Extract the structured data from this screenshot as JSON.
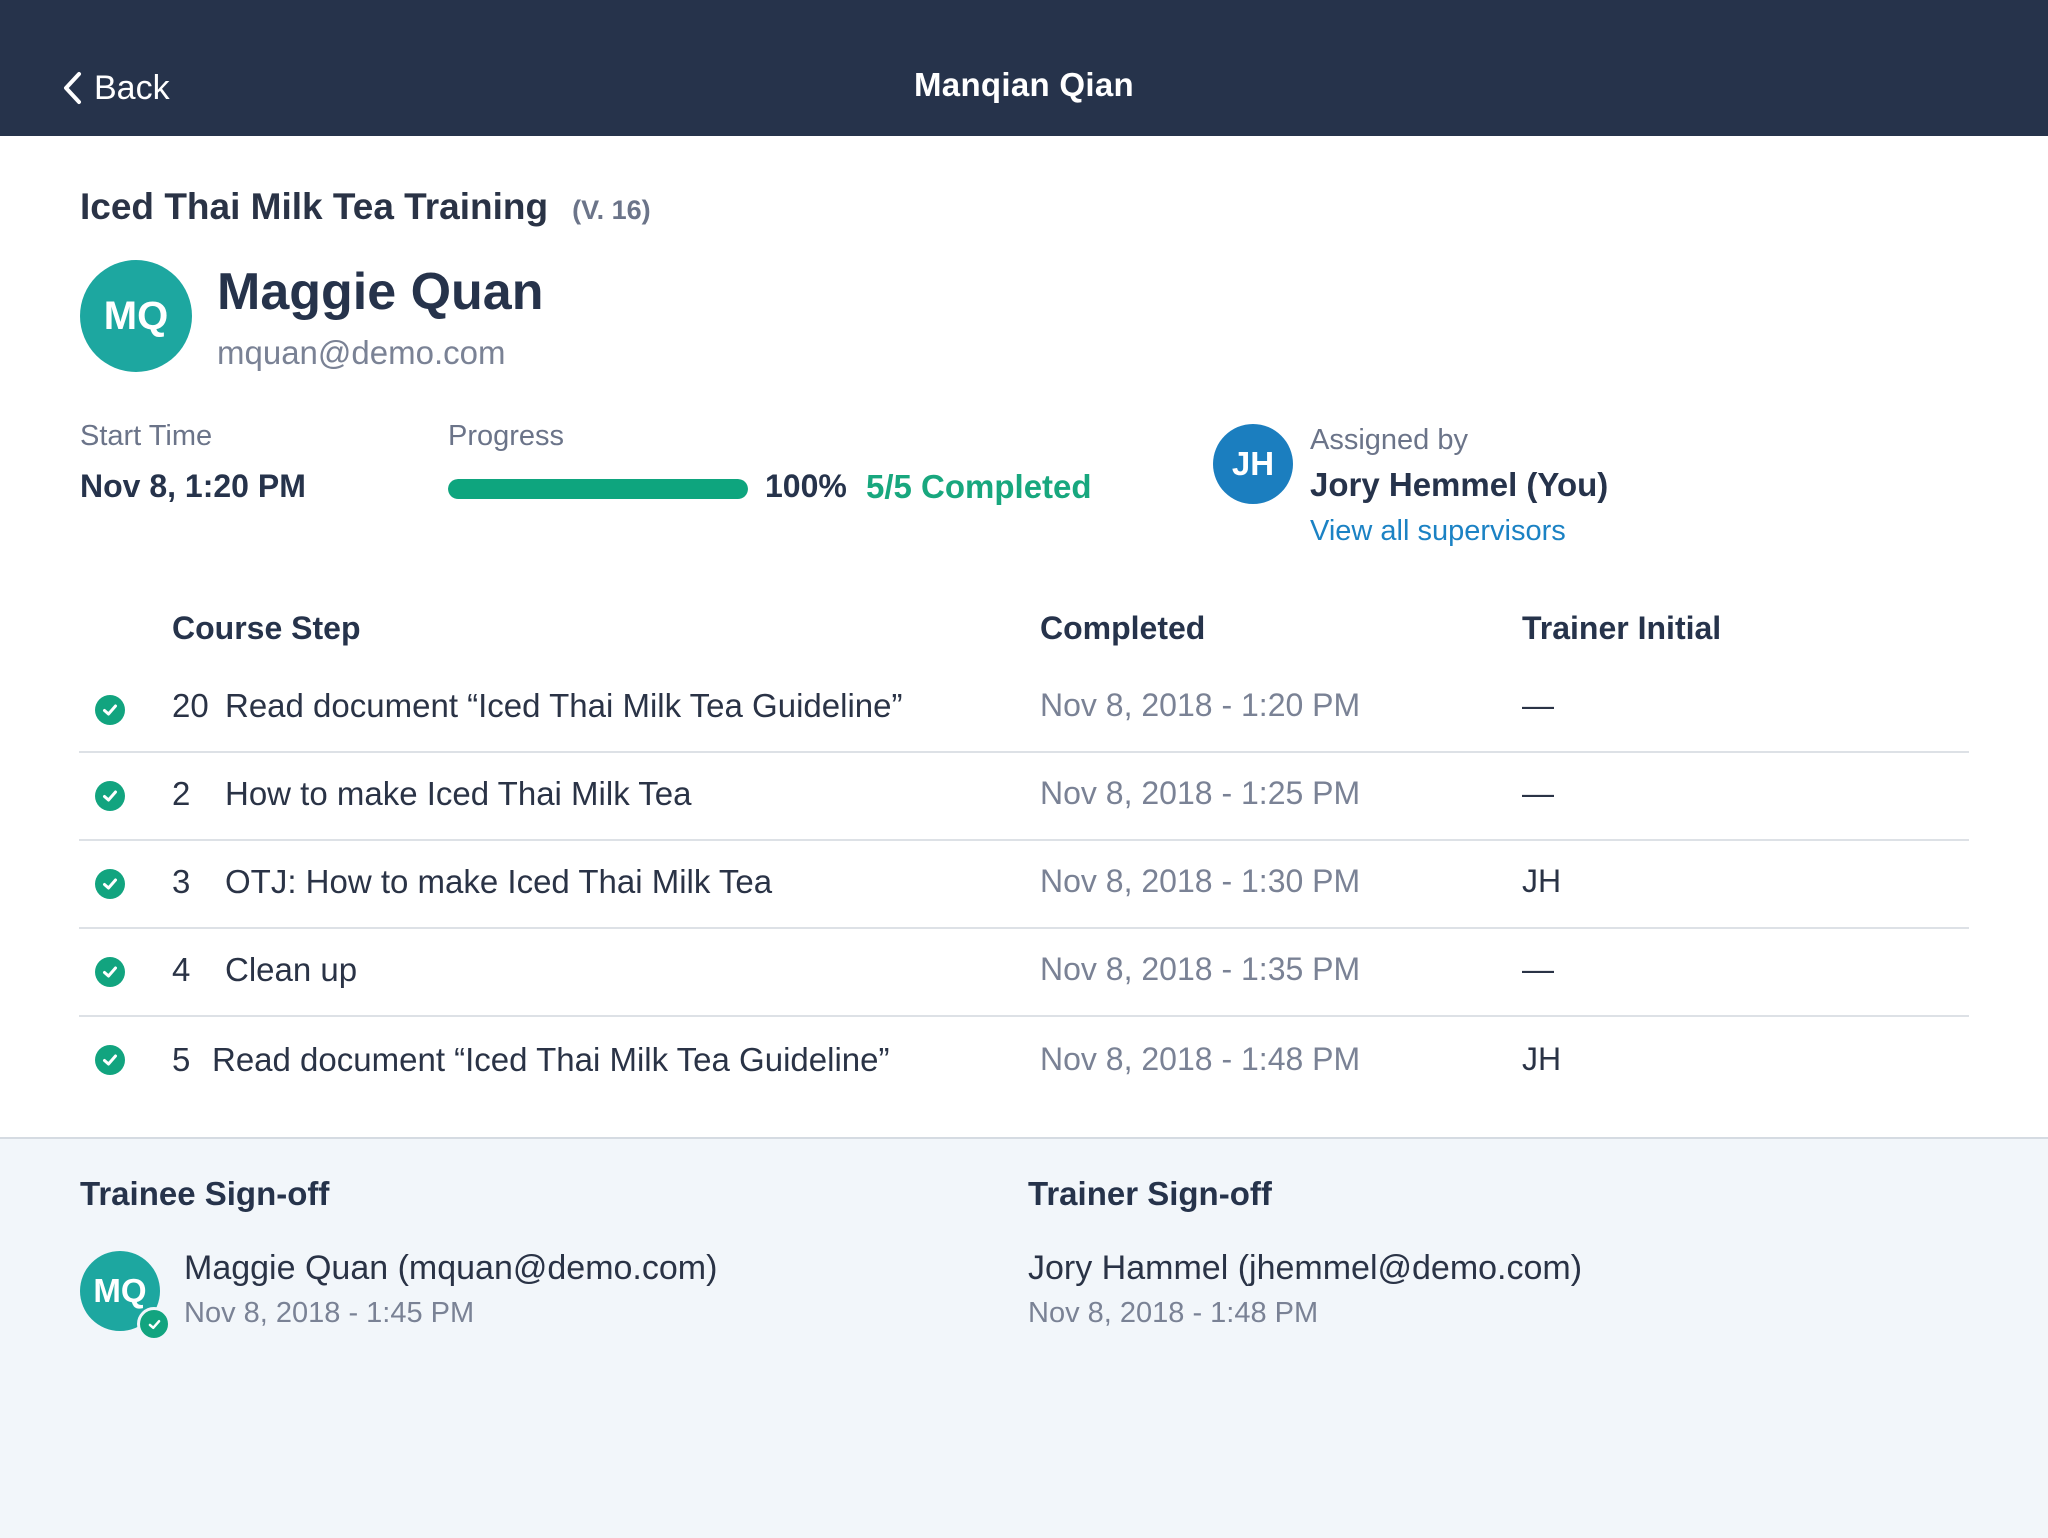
{
  "nav": {
    "back_label": "Back",
    "title": "Manqian Qian",
    "back_icon": "chevron-left-icon"
  },
  "course": {
    "title": "Iced Thai Milk Tea Training",
    "version": "(V. 16)"
  },
  "trainee": {
    "initials": "MQ",
    "name": "Maggie Quan",
    "email": "mquan@demo.com",
    "avatar_color": "#1da7a0"
  },
  "stats": {
    "start_label": "Start Time",
    "start_value": "Nov 8, 1:20 PM",
    "progress_label": "Progress",
    "progress_fraction": 1.0,
    "progress_percent": "100%",
    "progress_completed": "5/5 Completed",
    "progress_color": "#0ea57e"
  },
  "assigned": {
    "initials": "JH",
    "label": "Assigned by",
    "name": "Jory Hemmel (You)",
    "view_all": "View all supervisors",
    "avatar_color": "#1b7ebf"
  },
  "table": {
    "headers": {
      "step": "Course Step",
      "completed": "Completed",
      "trainer": "Trainer Initial"
    },
    "rows": [
      {
        "num": "20",
        "name": "Read document “Iced Thai Milk Tea Guideline”",
        "completed": "Nov 8, 2018 - 1:20 PM",
        "initial": "—",
        "status_icon": "check-circle-icon"
      },
      {
        "num": "2",
        "name": "How to make Iced Thai Milk Tea",
        "completed": "Nov 8, 2018 - 1:25 PM",
        "initial": "—",
        "status_icon": "check-circle-icon"
      },
      {
        "num": "3",
        "name": "OTJ: How to make Iced Thai Milk Tea",
        "completed": "Nov 8, 2018 - 1:30 PM",
        "initial": "JH",
        "status_icon": "check-circle-icon"
      },
      {
        "num": "4",
        "name": "Clean up",
        "completed": "Nov 8, 2018 - 1:35 PM",
        "initial": "—",
        "status_icon": "check-circle-icon"
      },
      {
        "num": "5",
        "name": "Read document “Iced Thai Milk Tea Guideline”",
        "completed": "Nov 8, 2018 - 1:48 PM",
        "initial": "JH",
        "status_icon": "check-circle-icon"
      }
    ]
  },
  "signoff": {
    "trainee_heading": "Trainee Sign-off",
    "trainee_initials": "MQ",
    "trainee_name": "Maggie Quan (mquan@demo.com)",
    "trainee_date": "Nov 8, 2018 - 1:45 PM",
    "trainer_heading": "Trainer Sign-off",
    "trainer_name": "Jory Hammel (jhemmel@demo.com)",
    "trainer_date": "Nov 8, 2018 - 1:48 PM"
  }
}
